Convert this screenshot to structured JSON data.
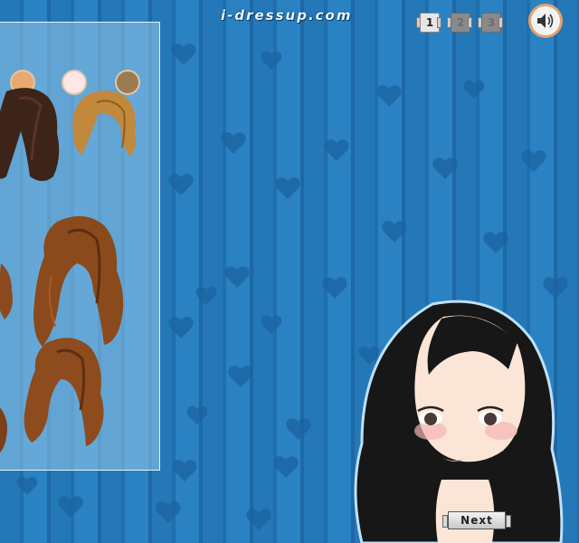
{
  "site": {
    "logo_text": "i-dressup.com"
  },
  "page_nav": {
    "pages": [
      "1",
      "2",
      "3"
    ],
    "current": "1"
  },
  "sound": {
    "icon": "speaker-icon"
  },
  "panel": {
    "skin_tones": [
      {
        "name": "tan-swatch",
        "color": "#e9a96e"
      },
      {
        "name": "pale-swatch",
        "color": "#fde8e6"
      },
      {
        "name": "olive-swatch",
        "color": "#9c7a52"
      }
    ],
    "hair_options": [
      {
        "name": "hair-dark-brown-long",
        "color": "#3d2418"
      },
      {
        "name": "hair-golden-wavy",
        "color": "#c2883c"
      },
      {
        "name": "hair-auburn-partial-1",
        "color": "#8a4a1e"
      },
      {
        "name": "hair-auburn-long-wavy",
        "color": "#8b4a1c"
      },
      {
        "name": "hair-auburn-partial-2",
        "color": "#7d3f17"
      },
      {
        "name": "hair-auburn-medium-wavy",
        "color": "#8e4b1d"
      }
    ]
  },
  "navigation": {
    "next_label": "Next"
  },
  "colors": {
    "background": "#2478b8",
    "accent": "#e3a06d"
  }
}
